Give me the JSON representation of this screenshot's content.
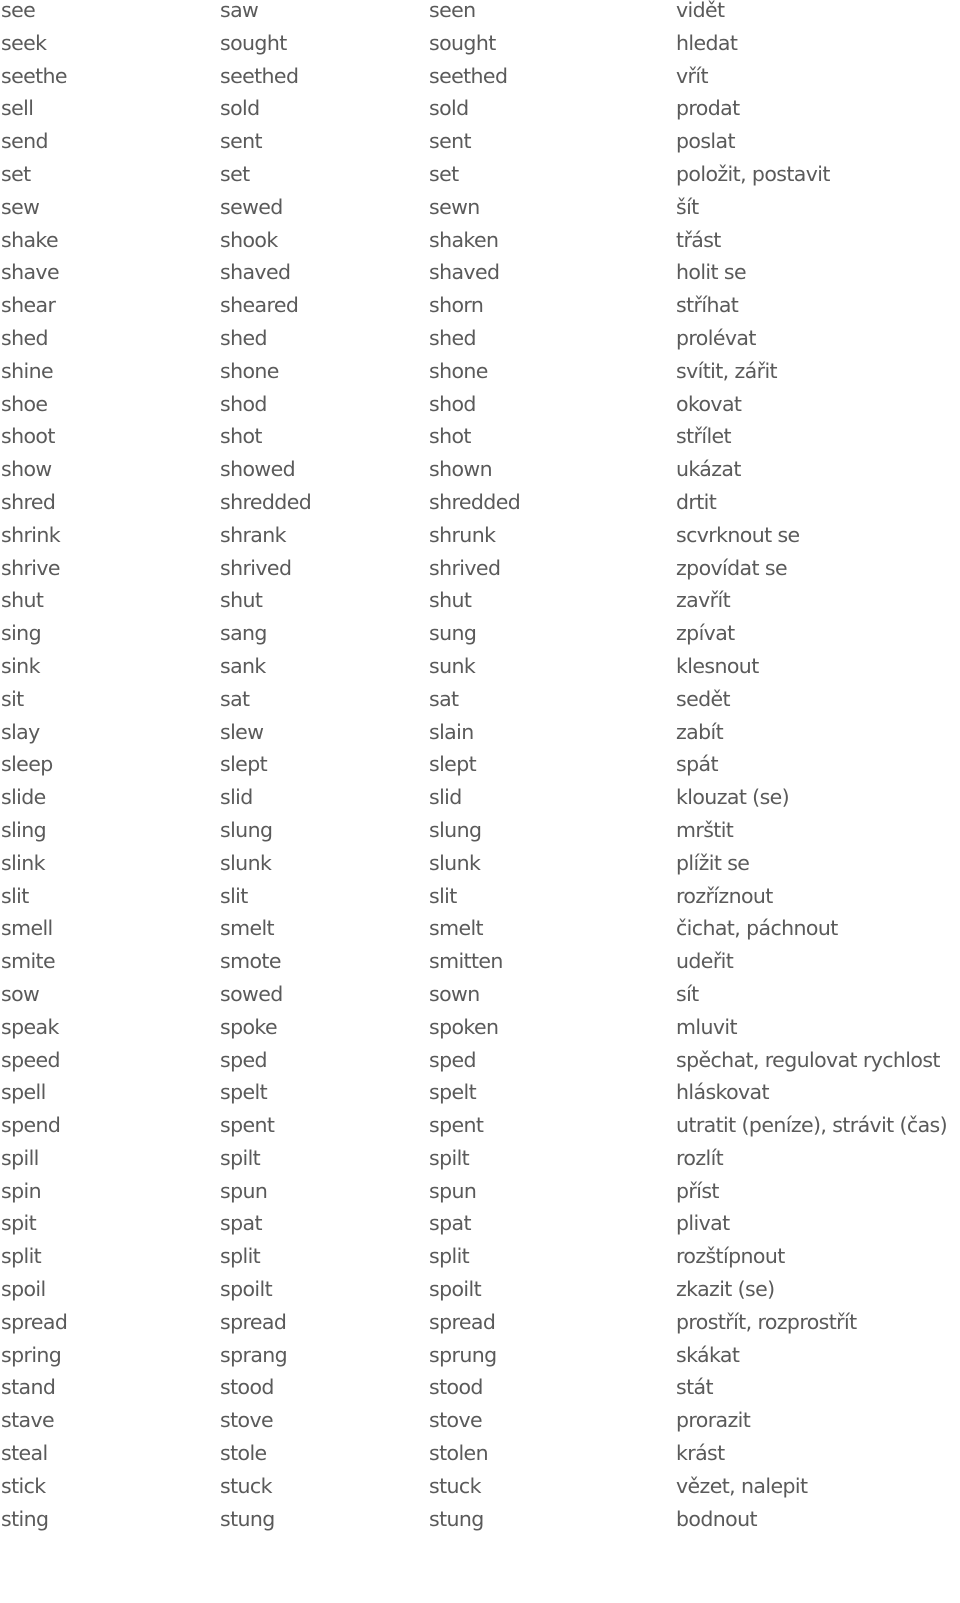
{
  "table": {
    "rows": [
      {
        "base": "see",
        "past": "saw",
        "participle": "seen",
        "translation": "vidět"
      },
      {
        "base": "seek",
        "past": "sought",
        "participle": "sought",
        "translation": "hledat"
      },
      {
        "base": "seethe",
        "past": "seethed",
        "participle": "seethed",
        "translation": "vřít"
      },
      {
        "base": "sell",
        "past": "sold",
        "participle": "sold",
        "translation": "prodat"
      },
      {
        "base": "send",
        "past": "sent",
        "participle": "sent",
        "translation": "poslat"
      },
      {
        "base": "set",
        "past": "set",
        "participle": "set",
        "translation": "položit, postavit"
      },
      {
        "base": "sew",
        "past": "sewed",
        "participle": "sewn",
        "translation": "šít"
      },
      {
        "base": "shake",
        "past": "shook",
        "participle": "shaken",
        "translation": "třást"
      },
      {
        "base": "shave",
        "past": "shaved",
        "participle": "shaved",
        "translation": "holit se"
      },
      {
        "base": "shear",
        "past": "sheared",
        "participle": "shorn",
        "translation": "stříhat"
      },
      {
        "base": "shed",
        "past": "shed",
        "participle": "shed",
        "translation": "prolévat"
      },
      {
        "base": "shine",
        "past": "shone",
        "participle": "shone",
        "translation": "svítit, zářit"
      },
      {
        "base": "shoe",
        "past": "shod",
        "participle": "shod",
        "translation": "okovat"
      },
      {
        "base": "shoot",
        "past": "shot",
        "participle": "shot",
        "translation": "střílet"
      },
      {
        "base": "show",
        "past": "showed",
        "participle": "shown",
        "translation": "ukázat"
      },
      {
        "base": "shred",
        "past": "shredded",
        "participle": "shredded",
        "translation": "drtit"
      },
      {
        "base": "shrink",
        "past": "shrank",
        "participle": "shrunk",
        "translation": "scvrknout se"
      },
      {
        "base": "shrive",
        "past": "shrived",
        "participle": "shrived",
        "translation": "zpovídat se"
      },
      {
        "base": "shut",
        "past": "shut",
        "participle": "shut",
        "translation": "zavřít"
      },
      {
        "base": "sing",
        "past": "sang",
        "participle": "sung",
        "translation": "zpívat"
      },
      {
        "base": "sink",
        "past": "sank",
        "participle": "sunk",
        "translation": "klesnout"
      },
      {
        "base": "sit",
        "past": "sat",
        "participle": "sat",
        "translation": "sedět"
      },
      {
        "base": "slay",
        "past": "slew",
        "participle": "slain",
        "translation": "zabít"
      },
      {
        "base": "sleep",
        "past": "slept",
        "participle": "slept",
        "translation": "spát"
      },
      {
        "base": "slide",
        "past": "slid",
        "participle": "slid",
        "translation": "klouzat (se)"
      },
      {
        "base": "sling",
        "past": "slung",
        "participle": "slung",
        "translation": "mrštit"
      },
      {
        "base": "slink",
        "past": "slunk",
        "participle": "slunk",
        "translation": "plížit se"
      },
      {
        "base": "slit",
        "past": "slit",
        "participle": "slit",
        "translation": "rozříznout"
      },
      {
        "base": "smell",
        "past": "smelt",
        "participle": "smelt",
        "translation": "čichat, páchnout"
      },
      {
        "base": "smite",
        "past": "smote",
        "participle": "smitten",
        "translation": "udeřit"
      },
      {
        "base": "sow",
        "past": "sowed",
        "participle": "sown",
        "translation": "sít"
      },
      {
        "base": "speak",
        "past": "spoke",
        "participle": "spoken",
        "translation": "mluvit"
      },
      {
        "base": "speed",
        "past": "sped",
        "participle": "sped",
        "translation": "spěchat, regulovat rychlost"
      },
      {
        "base": "spell",
        "past": "spelt",
        "participle": "spelt",
        "translation": "hláskovat"
      },
      {
        "base": "spend",
        "past": "spent",
        "participle": "spent",
        "translation": "utratit (peníze), strávit (čas)"
      },
      {
        "base": "spill",
        "past": "spilt",
        "participle": "spilt",
        "translation": "rozlít"
      },
      {
        "base": "spin",
        "past": "spun",
        "participle": "spun",
        "translation": "příst"
      },
      {
        "base": "spit",
        "past": "spat",
        "participle": "spat",
        "translation": "plivat"
      },
      {
        "base": "split",
        "past": "split",
        "participle": "split",
        "translation": "rozštípnout"
      },
      {
        "base": "spoil",
        "past": "spoilt",
        "participle": "spoilt",
        "translation": "zkazit (se)"
      },
      {
        "base": "spread",
        "past": "spread",
        "participle": "spread",
        "translation": "prostřít, rozprostřít"
      },
      {
        "base": "spring",
        "past": "sprang",
        "participle": "sprung",
        "translation": "skákat"
      },
      {
        "base": "stand",
        "past": "stood",
        "participle": "stood",
        "translation": "stát"
      },
      {
        "base": "stave",
        "past": "stove",
        "participle": "stove",
        "translation": "prorazit"
      },
      {
        "base": "steal",
        "past": "stole",
        "participle": "stolen",
        "translation": "krást"
      },
      {
        "base": "stick",
        "past": "stuck",
        "participle": "stuck",
        "translation": "vězet, nalepit"
      },
      {
        "base": "sting",
        "past": "stung",
        "participle": "stung",
        "translation": "bodnout"
      }
    ]
  }
}
